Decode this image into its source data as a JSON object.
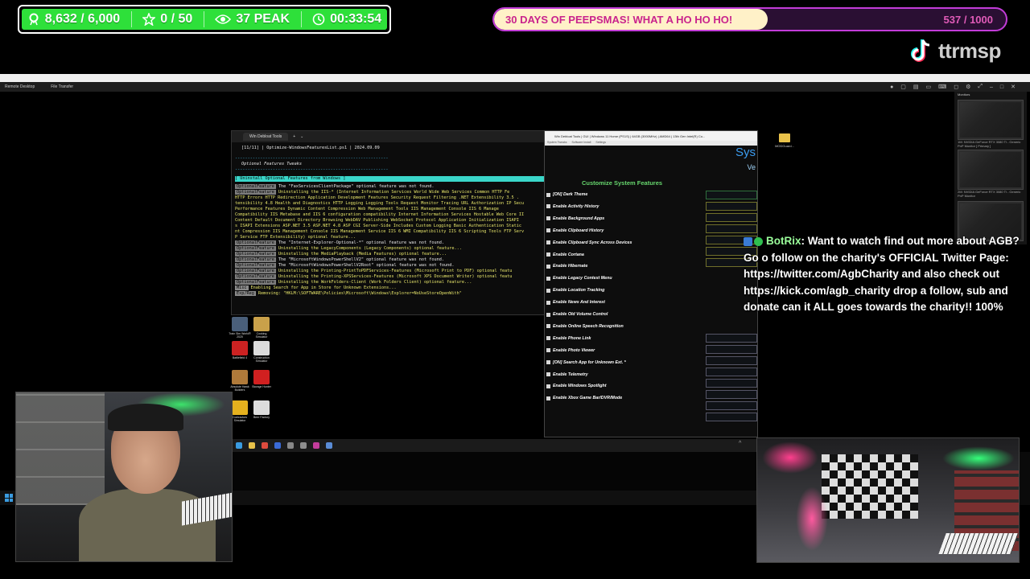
{
  "stats": {
    "likes": "8,632 / 6,000",
    "stars": "0 / 50",
    "viewers": "37 PEAK",
    "timer": "00:33:54"
  },
  "goal": {
    "title": "30 DAYS OF PEEPSMAS! WHAT A HO HO HO!",
    "count": "537 / 1000",
    "progress": 0.537,
    "fill_color": "#fff1c8",
    "border_color": "#c23cd8"
  },
  "tiktok": {
    "handle": "ttrmsp"
  },
  "remote_desktop": {
    "left_label": "Remote Desktop",
    "file_transfer": "File Transfer",
    "monitors_label": "Monitors",
    "monitor1": "1M: NVIDIA GeForce RTX 3080 Ti - Generic PnP Monitor [ Primary ]",
    "monitor2": "2M: NVIDIA GeForce RTX 3080 Ti - Generic PnP Monitor"
  },
  "terminal": {
    "tab": "Win Debloat Tools",
    "header": "[11/11] | Optimize-WindowsFeaturesList.ps1 | 2024.09.09",
    "section": "Optional Features Tweaks",
    "banner": "[ Uninstall Optional Features from Windows ]",
    "lines": [
      {
        "tag": "OptionalFeature",
        "text": "The \"FaxServicesClientPackage\" optional feature was not found."
      },
      {
        "tag": "OptionalFeature",
        "text": "Uninstalling the IIS-* (Internet Information Services World Wide Web Services Common HTTP Fe"
      },
      {
        "tag": "",
        "text": "HTTP Errors HTTP Redirection Application Development Features Security Request Filtering .NET Extensibility 3.5 ."
      },
      {
        "tag": "",
        "text": "tensibility 4.8 Health and Diagnostics HTTP Logging Logging Tools Request Monitor Tracing URL Authorization IP Secu"
      },
      {
        "tag": "",
        "text": "Performance Features Dynamic Content Compression Web Management Tools IIS Management Console IIS 6 Manage"
      },
      {
        "tag": "",
        "text": "Compatibility IIS Metabase and IIS 6 configuration compatibility Internet Information Services Hostable Web Core II"
      },
      {
        "tag": "",
        "text": "Content Default Document Directory Browsing WebDAV Publishing WebSocket Protocol Application Initialization ISAPI"
      },
      {
        "tag": "",
        "text": "s ISAPI Extensions ASP.NET 3.5 ASP.NET 4.8 ASP CGI Server-Side Includes Custom Logging Basic Authentication Static"
      },
      {
        "tag": "",
        "text": "nt Compression IIS Management Console IIS Management Service IIS 6 WMI Compatibility IIS 6 Scripting Tools FTP Serv"
      },
      {
        "tag": "",
        "text": "P Service FTP Extensibility) optional feature..."
      },
      {
        "tag": "OptionalFeature",
        "text": "The \"Internet-Explorer-Optional-*\" optional feature was not found."
      },
      {
        "tag": "OptionalFeature",
        "text": "Uninstalling the LegacyComponents (Legacy Components) optional feature..."
      },
      {
        "tag": "OptionalFeature",
        "text": "Uninstalling the MediaPlayback (Media Features) optional feature..."
      },
      {
        "tag": "OptionalFeature",
        "text": "The \"MicrosoftWindowsPowerShellV2\" optional feature was not found."
      },
      {
        "tag": "OptionalFeature",
        "text": "The \"MicrosoftWindowsPowerShellV2Root\" optional feature was not found."
      },
      {
        "tag": "OptionalFeature",
        "text": "Uninstalling the Printing-PrintToPDFServices-Features (Microsoft Print to PDF) optional featu"
      },
      {
        "tag": "OptionalFeature",
        "text": "Uninstalling the Printing-XPSServices-Features (Microsoft XPS Document Writer) optional featu"
      },
      {
        "tag": "OptionalFeature",
        "text": "Uninstalling the WorkFolders-Client (Work Folders Client) optional feature..."
      },
      {
        "tag": "Misc",
        "text": "Enabling Search for App in Store for Unknown Extensions..."
      },
      {
        "tag": "Exp/Reg",
        "text": "Removing: \"HKLM:\\SOFTWARE\\Policies\\Microsoft\\Windows\\Explorer=NoUseStoreOpenWith\""
      }
    ]
  },
  "tweaks": {
    "title": "Win Debloat Tools | GUI | Windows 11 Home (PS1S) | 64GB (3000MHz) | AMD64 | 13th Gen Intel(R) Co...",
    "tabs": [
      "System Tweaks",
      "Software Install",
      "Settings"
    ],
    "heading": "Customize System Features",
    "sys_label": "Sys",
    "ver_label": "Ve",
    "options": [
      "[ON] Dark Theme",
      "Enable Activity History",
      "Enable Background Apps",
      "Enable Clipboard History",
      "Enable Clipboard Sync Across Devices",
      "Enable Cortana",
      "Enable Hibernate",
      "Enable Legacy Context Menu",
      "Enable Location Tracking",
      "Enable News And Interest",
      "Enable Old Volume Control",
      "Enable Online Speech Recognition",
      "Enable Phone Link",
      "Enable Photo Viewer",
      "[ON] Search App for Unknown Ext. *",
      "Enable Telemetry",
      "Enable Windows Spotlight",
      "Enable Xbox Game Bar/DVR/Mode"
    ]
  },
  "desktop": {
    "folder": "MODGuard...",
    "icons": [
      {
        "label": "Train Sim World® 2020",
        "color": "#4a5f7a"
      },
      {
        "label": "Cooking Simulator",
        "color": "#c9a14a"
      },
      {
        "label": "Battlefield 4",
        "color": "#cc2222"
      },
      {
        "label": "Construction Simulator",
        "color": "#dcdcdc"
      },
      {
        "label": "Absolute Hawk Builders",
        "color": "#b07a3a"
      },
      {
        "label": "Storage Hunter",
        "color": "#d12020"
      },
      {
        "label": "Contractors Simulator",
        "color": "#e5b11e"
      },
      {
        "label": "Beer Factory",
        "color": "#dddddd"
      }
    ]
  },
  "chat": {
    "user": "BotRix",
    "message": ": Want to watch find out more about AGB? Go o follow on the charity's OFFICIAL Twitter Page: https://twitter.com/AgbCharity and also check out https://kick.com/agb_charity drop a follow, sub and donate can it ALL goes towards the charity!! 100%"
  },
  "taskbar": {
    "icons": [
      "windows-icon",
      "file-explorer-icon",
      "chrome-icon",
      "terminal-icon",
      "tool-icon",
      "settings-icon",
      "app-icon",
      "media-icon"
    ]
  }
}
